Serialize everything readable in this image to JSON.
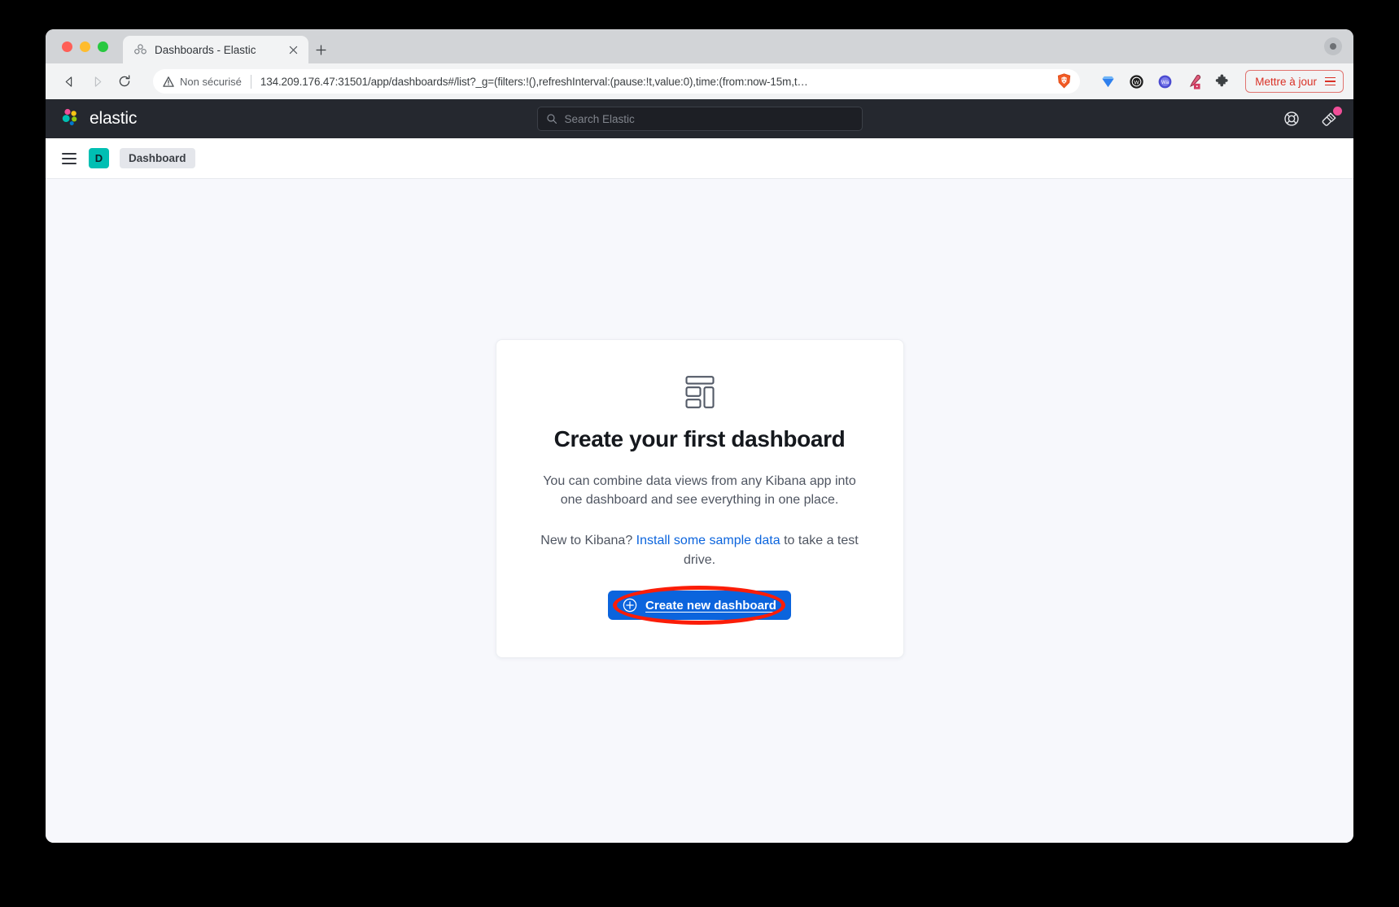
{
  "browser": {
    "tab": {
      "title": "Dashboards - Elastic",
      "favicon_icon": "elastic-cluster-icon",
      "close_icon": "close-icon"
    },
    "new_tab_icon": "plus-icon",
    "window_controls": [
      "close",
      "minimize",
      "zoom"
    ],
    "nav": {
      "back_icon": "back-arrow-icon",
      "forward_icon": "forward-arrow-icon",
      "reload_icon": "reload-icon",
      "bookmark_icon": "bookmark-icon"
    },
    "omnibox": {
      "security_icon": "warning-triangle-icon",
      "security_label": "Non sécurisé",
      "url": "134.209.176.47:31501/app/dashboards#/list?_g=(filters:!(),refreshInterval:(pause:!t,value:0),time:(from:now-15m,t…",
      "shield_icon": "brave-shield-icon"
    },
    "extensions": [
      {
        "icon": "diamond-extension-icon",
        "color": "#3b82f6"
      },
      {
        "icon": "circle-w-extension-icon",
        "color": "#1d1d1d"
      },
      {
        "icon": "wappalyzer-extension-icon",
        "color": "#5b5bd6"
      },
      {
        "icon": "eyedropper-extension-icon",
        "color": "#d6336c"
      },
      {
        "icon": "puzzle-extensions-icon",
        "color": "#3c4043"
      }
    ],
    "update_button": {
      "label": "Mettre à jour",
      "menu_icon": "hamburger-menu-icon",
      "color": "#d93025"
    },
    "tab_strip_right_icon": "more-icon"
  },
  "kibana": {
    "header": {
      "logo_icon": "elastic-logo-icon",
      "wordmark": "elastic",
      "search": {
        "placeholder": "Search Elastic",
        "icon": "search-icon"
      },
      "help_icon": "help-lifebuoy-icon",
      "news_icon": "news-megaphone-icon",
      "news_badge_color": "#f04e98"
    },
    "breadcrumb_bar": {
      "nav_toggle_icon": "hamburger-menu-icon",
      "space_initial": "D",
      "space_color": "#00bfb3",
      "breadcrumb": "Dashboard"
    },
    "empty_state": {
      "glyph_icon": "dashboard-layout-icon",
      "title": "Create your first dashboard",
      "description": "You can combine data views from any Kibana app into one dashboard and see everything in one place.",
      "prompt_prefix": "New to Kibana? ",
      "prompt_link": "Install some sample data",
      "prompt_suffix": " to take a test drive.",
      "create_button": {
        "label": "Create new dashboard",
        "icon": "plus-in-circle-icon",
        "background": "#0b64dd"
      }
    }
  },
  "annotation": {
    "shape": "ellipse",
    "color": "#fb1d08",
    "target": "create-new-dashboard-button"
  }
}
